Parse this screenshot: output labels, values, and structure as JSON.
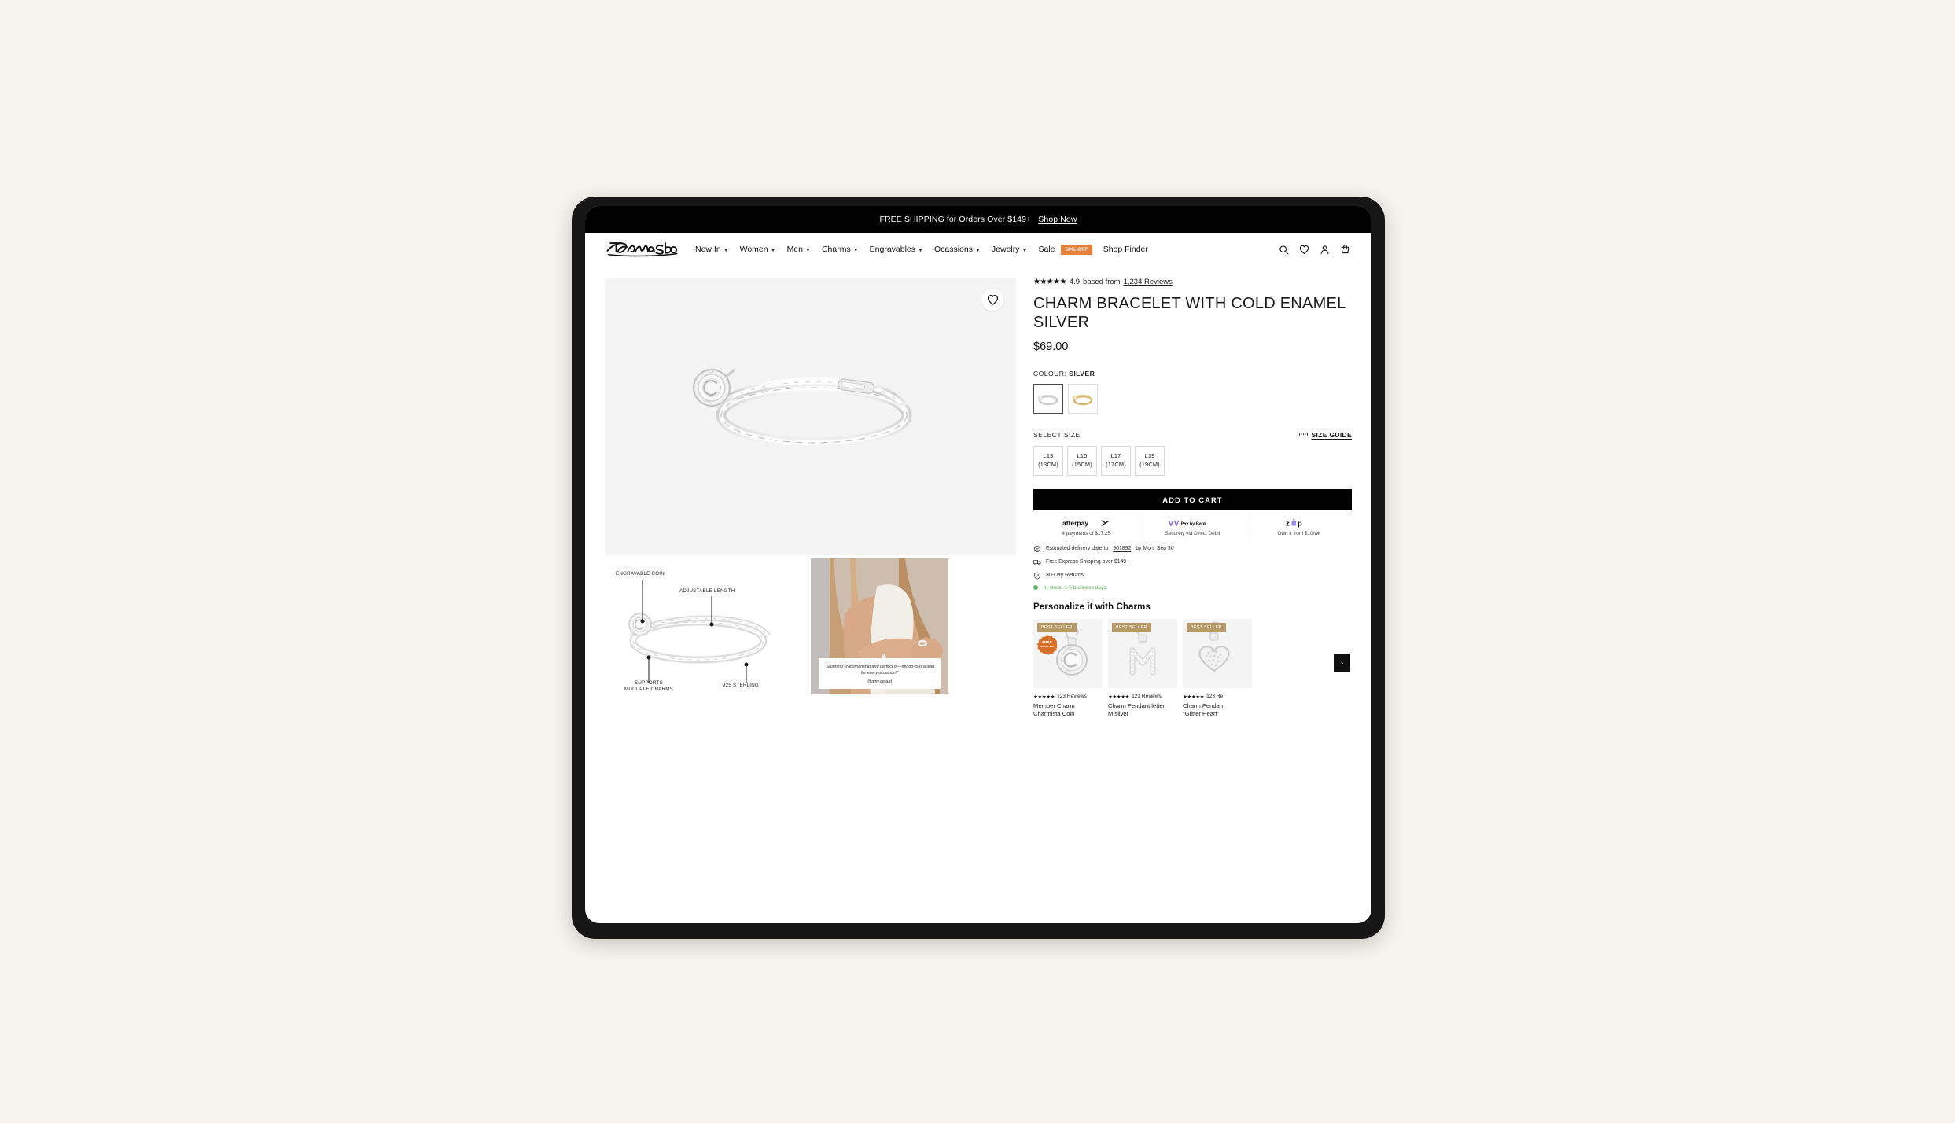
{
  "announcement": {
    "text": "FREE SHIPPING for Orders Over $149+",
    "link_label": "Shop Now"
  },
  "header": {
    "brand": "Thomas Sabo",
    "nav": [
      {
        "label": "New In",
        "has_caret": true
      },
      {
        "label": "Women",
        "has_caret": true
      },
      {
        "label": "Men",
        "has_caret": true
      },
      {
        "label": "Charms",
        "has_caret": true
      },
      {
        "label": "Engravables",
        "has_caret": true
      },
      {
        "label": "Ocassions",
        "has_caret": true
      },
      {
        "label": "Jewelry",
        "has_caret": true
      },
      {
        "label": "Sale",
        "has_caret": false,
        "badge": "50% OFF"
      },
      {
        "label": "Shop Finder",
        "has_caret": false
      }
    ],
    "icons": [
      "search-icon",
      "wishlist-heart-icon",
      "account-icon",
      "cart-icon"
    ]
  },
  "gallery": {
    "wishlist_icon": "heart-icon",
    "diagram_annotations": [
      {
        "label": "ENGRAVABLE COIN"
      },
      {
        "label": "ADJUSTABLE LENGTH"
      },
      {
        "label": "SUPPORTS MULTIPLE CHARMS"
      },
      {
        "label": "925 STERLING"
      }
    ],
    "diagram_labels": {
      "engravable_coin": "ENGRAVABLE COIN",
      "adjustable_length": "ADJUSTABLE LENGTH",
      "supports_line1": "SUPPORTS",
      "supports_line2": "MULTIPLE CHARMS",
      "sterling": "925 STERLING"
    },
    "ugc": {
      "quote": "\"Stunning craftsmanship and perfect fit—my go-to bracelet for every occasion!\"",
      "handle": "@amy.gerard"
    }
  },
  "product": {
    "stars": "★★★★★",
    "rating": "4.9",
    "rating_prefix": "based from",
    "reviews_link": "1,234 Reviews",
    "title": "CHARM BRACELET WITH COLD ENAMEL SILVER",
    "price": "$69.00",
    "colour_label": "COLOUR:",
    "colour_value": "SILVER",
    "swatches": [
      {
        "name": "silver",
        "selected": true,
        "color": "#c9c9c9"
      },
      {
        "name": "gold",
        "selected": false,
        "color": "#d8b46a"
      }
    ],
    "size_label": "SELECT SIZE",
    "size_guide_label": "SIZE GUIDE",
    "sizes": [
      {
        "code": "L13",
        "cm": "(13CM)"
      },
      {
        "code": "L15",
        "cm": "(15CM)"
      },
      {
        "code": "L17",
        "cm": "(17CM)"
      },
      {
        "code": "L19",
        "cm": "(19CM)"
      }
    ],
    "add_to_cart": "ADD TO CART",
    "payments": [
      {
        "logo": "afterpay",
        "logo_text": "afterpay",
        "sub": "4 payments of $17.25"
      },
      {
        "logo": "paybybank",
        "logo_text": "Pay by Bank",
        "sub": "Securely via Direct Debit"
      },
      {
        "logo": "zip",
        "logo_text": "zip",
        "sub": "Own it from $10/wk"
      }
    ],
    "info_lines": [
      {
        "icon": "package-icon",
        "pre": "Estimated delivery date to ",
        "link": "901892",
        "post": " by Mon, Sep 30"
      },
      {
        "icon": "truck-icon",
        "pre": "Free Express Shipping over $149+",
        "link": "",
        "post": ""
      },
      {
        "icon": "shield-check-icon",
        "pre": "30-Day Returns",
        "link": "",
        "post": ""
      }
    ],
    "stock_text": "In stock. 1-5 business days."
  },
  "charms": {
    "title": "Personalize it with Charms",
    "next_arrow": "›",
    "items": [
      {
        "badge": "BEST SELLER",
        "free_badge_line1": "FREE",
        "free_badge_line2": "ENGRAVING",
        "stars": "★★★★★",
        "reviews": "123 Reviews",
        "name_line1": "Member Charm",
        "name_line2": "Charmista Coin",
        "art": "coin"
      },
      {
        "badge": "BEST SELLER",
        "stars": "★★★★★",
        "reviews": "123 Reviews",
        "name_line1": "Charm Pendant letter",
        "name_line2": "M silver",
        "art": "letter-m"
      },
      {
        "badge": "BEST SELLER",
        "stars": "★★★★★",
        "reviews": "123 Re",
        "name_line1": "Charm Pendan",
        "name_line2": "\"Glitter Heart\"",
        "art": "heart"
      }
    ]
  },
  "colors": {
    "page_bg": "#f7f3ee",
    "device_frame": "#161616",
    "accent_orange": "#e8803a",
    "badge_gold": "#b79a67",
    "free_badge": "#d9702c",
    "stock_green": "#5cb860",
    "cta_black": "#000000"
  }
}
